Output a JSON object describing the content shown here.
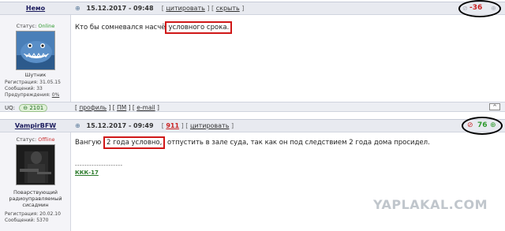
{
  "post1": {
    "author": "Немо",
    "datetime": "15.12.2017 - 09:48",
    "actions": [
      "цитировать",
      "скрыть"
    ],
    "status_label": "Статус:",
    "status_value": "Online",
    "avatar_caption": "Шутник",
    "stats": {
      "reg": "Регистрация: 31.05.15",
      "msgs": "Сообщений: 33",
      "warn_label": "Предупреждения:",
      "warn_value": "0%"
    },
    "text_before": "Кто бы сомневался насчё",
    "text_highlight": "условного срока.",
    "rating": "-36",
    "uq_label": "UQ:",
    "uq_value": "2101",
    "footer_links": [
      "профиль",
      "ПМ",
      "e-mail"
    ],
    "up_label": "^"
  },
  "post2": {
    "author": "VampirBFW",
    "datetime": "15.12.2017 - 09:49",
    "hot_count": "911",
    "actions": [
      "цитировать"
    ],
    "status_label": "Статус:",
    "status_value": "Offline",
    "avatar_caption_1": "Повар​ствующий",
    "avatar_caption_2": "радиоуправляемый",
    "avatar_caption_3": "сисадмин",
    "stats": {
      "reg": "Регистрация: 20.02.10",
      "msgs": "Сообщений: 5370"
    },
    "text_before": "Вангую",
    "text_highlight": "2 года условно,",
    "text_after": "отпустить в зале суда, так как он под следствием 2 года дома просидел.",
    "sig_line": "--------------------",
    "sig_link": "ККК-17",
    "rating": "76"
  },
  "watermark": "YAPLAKAL.COM",
  "colors": {
    "negative": "#c82020",
    "positive": "#2f9a2f",
    "highlight_border": "#d01818"
  }
}
